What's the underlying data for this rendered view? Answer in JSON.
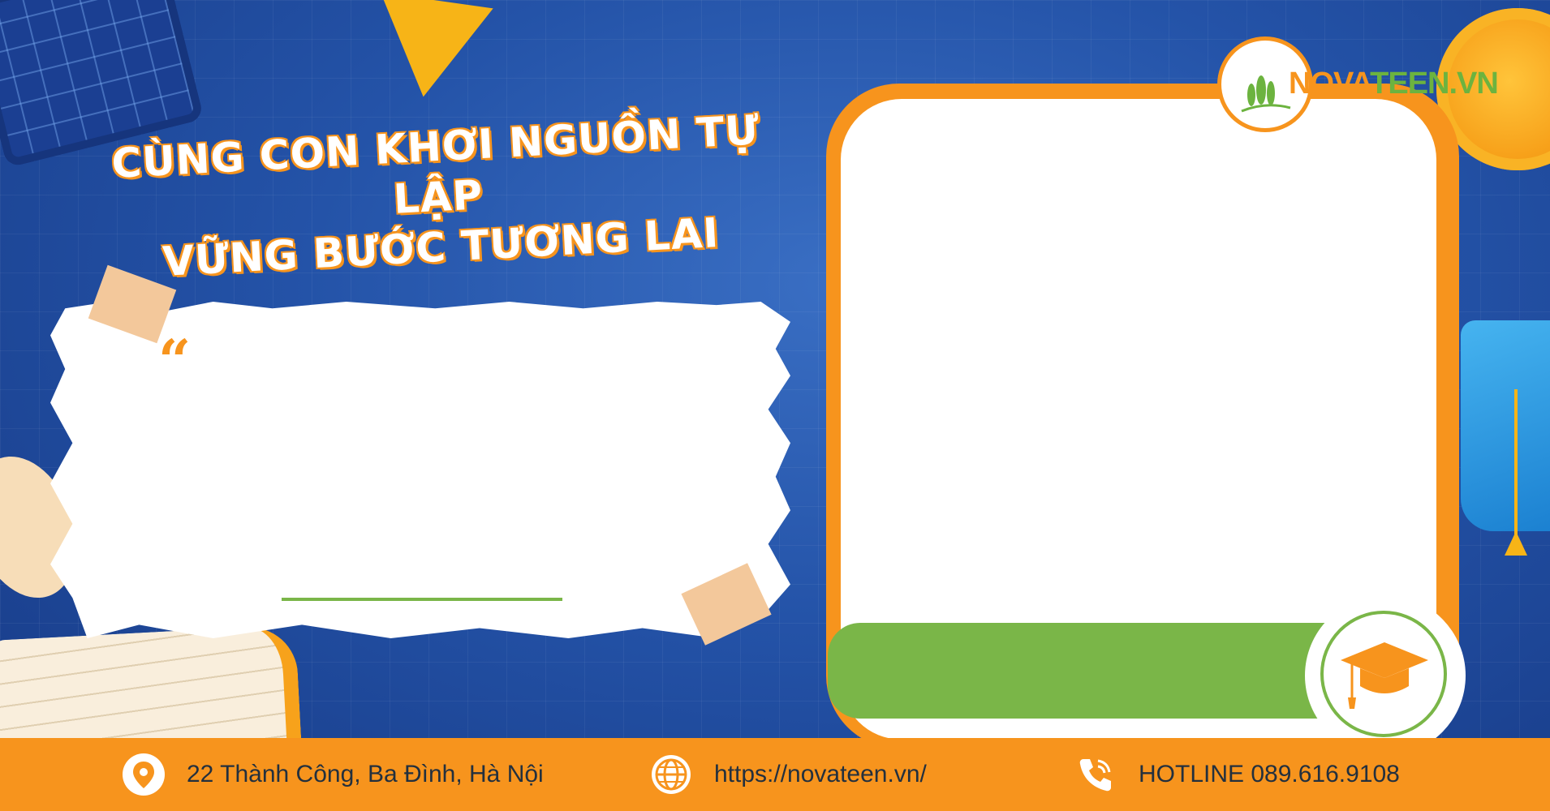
{
  "header": {
    "line1": "CÙNG CON KHƠI NGUỒN TỰ LẬP",
    "line2": "VỮNG BƯỚC TƯƠNG LAI"
  },
  "quote": {
    "mark": "“"
  },
  "logo": {
    "part1": "NOVA",
    "part2": "TEEN.VN"
  },
  "footer": {
    "address": "22 Thành Công, Ba Đình, Hà Nội",
    "website": "https://novateen.vn/",
    "hotline": "HOTLINE 089.616.9108"
  },
  "colors": {
    "orange": "#f7941d",
    "green": "#7ab648",
    "blue": "#1f4aa0"
  },
  "icons": [
    "location-pin-icon",
    "globe-icon",
    "phone-icon",
    "graduation-cap-icon"
  ]
}
